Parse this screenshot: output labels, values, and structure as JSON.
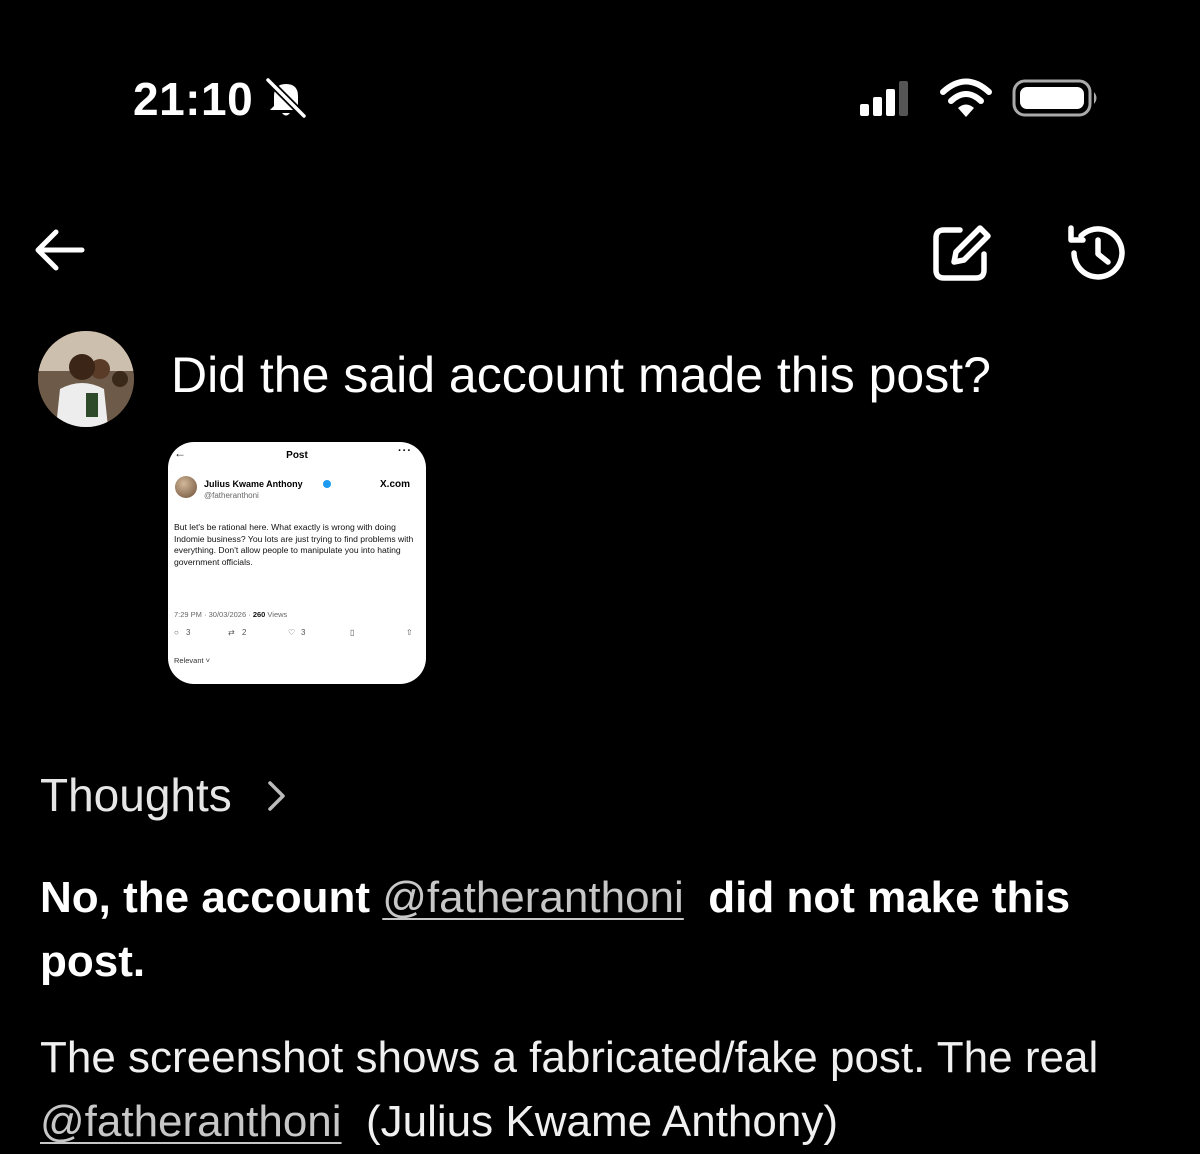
{
  "status_bar": {
    "time": "21:10",
    "icons": [
      "bell-slash-icon",
      "signal-icon",
      "wifi-icon",
      "battery-icon"
    ]
  },
  "nav": {
    "icons": [
      "back-arrow-icon",
      "edit-icon",
      "history-icon"
    ]
  },
  "user_message": {
    "text": "Did the said account made this post?"
  },
  "attachment": {
    "header_title": "Post",
    "author_name": "Julius Kwame Anthony",
    "author_handle": "@fatheranthoni",
    "watermark": "X.com",
    "body": "But let's be rational here. What exactly is wrong with doing Indomie business? You lots are just trying to find problems with everything. Don't allow people to manipulate you into hating government officials.",
    "timestamp": "7:29 PM · 30/03/2026 ·",
    "views_count": "260",
    "views_label": "Views",
    "replies": "3",
    "reposts": "2",
    "likes": "3",
    "sort_label": "Relevant ˅"
  },
  "response": {
    "thoughts_label": "Thoughts",
    "answer_prefix": "No, the account ",
    "answer_handle": "@fatheranthoni",
    "answer_suffix": "  did not make this post.",
    "paragraph_prefix": "The screenshot shows a fabricated/fake post. The real ",
    "paragraph_handle": "@fatheranthoni",
    "paragraph_suffix": "  (Julius Kwame Anthony)"
  },
  "colors": {
    "background": "#000000",
    "text": "#ffffff",
    "link": "#c7c7c7",
    "verified_badge": "#1d9bf0"
  }
}
